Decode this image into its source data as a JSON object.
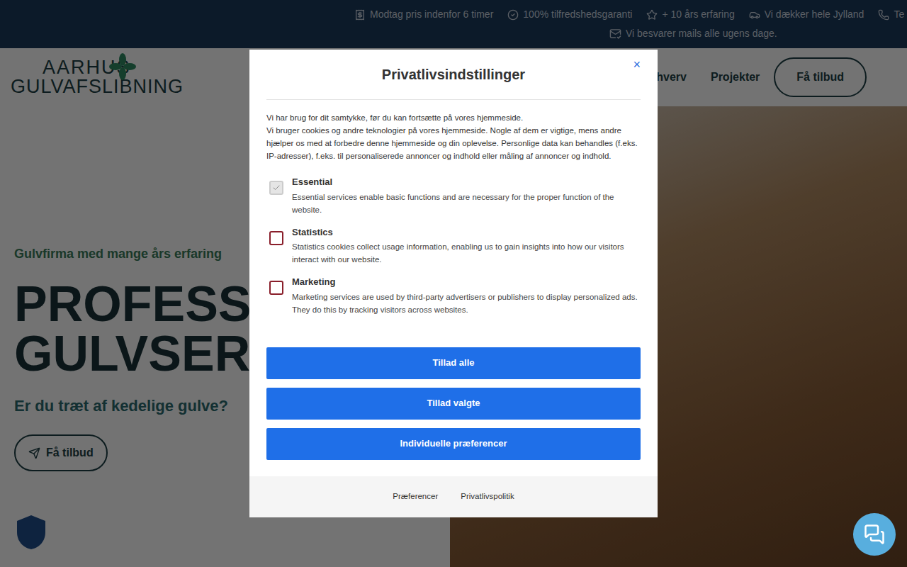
{
  "top_bar": {
    "rows": [
      [
        "Modtag pris indenfor 6 timer",
        "100% tilfredshedsgaranti",
        "+ 10 års erfaring",
        "Vi dækker hele Jylland",
        "Te"
      ],
      [
        "Vi besvarer mails alle ugens dage."
      ]
    ]
  },
  "header": {
    "logo": {
      "line1": "AARHUS",
      "line2": "GULVAFSLIBNING"
    },
    "nav": [
      "Erhverv",
      "Projekter"
    ],
    "cta": "Få tilbud"
  },
  "hero": {
    "eyebrow": "Gulvfirma med mange års erfaring",
    "title_lines": [
      "PROFESSIO",
      "GULVSERVI"
    ],
    "subtitle": "Er du træt af kedelige gulve?",
    "cta": "Få tilbud"
  },
  "modal": {
    "title": "Privatlivsindstillinger",
    "close": "×",
    "intro": [
      "Vi har brug for dit samtykke, før du kan fortsætte på vores hjemmeside.",
      "Vi bruger cookies og andre teknologier på vores hjemmeside. Nogle af dem er vigtige, mens andre hjælper os med at forbedre denne hjemmeside og din oplevelse. Personlige data kan behandles (f.eks. IP-adresser), f.eks. til personaliserede annoncer og indhold eller måling af annoncer og indhold."
    ],
    "options": [
      {
        "label": "Essential",
        "description": "Essential services enable basic functions and are necessary for the proper function of the website.",
        "checked": true,
        "disabled": true
      },
      {
        "label": "Statistics",
        "description": "Statistics cookies collect usage information, enabling us to gain insights into how our visitors interact with our website.",
        "checked": false,
        "disabled": false
      },
      {
        "label": "Marketing",
        "description": "Marketing services are used by third-party advertisers or publishers to display personalized ads. They do this by tracking visitors across websites.",
        "checked": false,
        "disabled": false
      }
    ],
    "buttons": [
      "Tillad alle",
      "Tillad valgte",
      "Individuelle præferencer"
    ],
    "footer_links": [
      "Præferencer",
      "Privatlivspolitik"
    ]
  }
}
